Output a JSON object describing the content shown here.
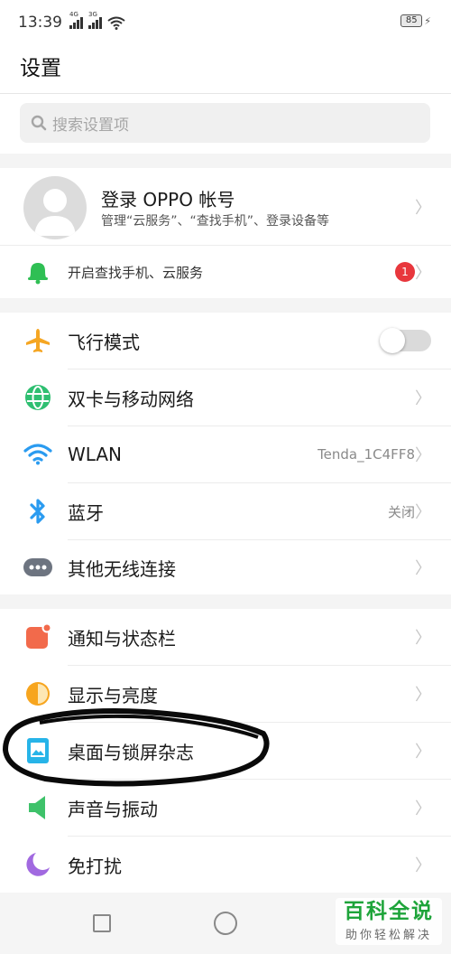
{
  "status_bar": {
    "time": "13:39",
    "net1": "4G",
    "net2": "3G",
    "battery": "85"
  },
  "header": {
    "title": "设置"
  },
  "search": {
    "placeholder": "搜索设置项"
  },
  "account": {
    "title": "登录 OPPO 帐号",
    "subtitle": "管理“云服务”、“查找手机”、登录设备等"
  },
  "find_phone": {
    "label": "开启查找手机、云服务",
    "badge": "1"
  },
  "network": {
    "airplane": {
      "label": "飞行模式",
      "on": false
    },
    "dual_sim": {
      "label": "双卡与移动网络"
    },
    "wlan": {
      "label": "WLAN",
      "value": "Tenda_1C4FF8"
    },
    "bluetooth": {
      "label": "蓝牙",
      "value": "关闭"
    },
    "other_wireless": {
      "label": "其他无线连接"
    }
  },
  "display": {
    "notifications": {
      "label": "通知与状态栏"
    },
    "brightness": {
      "label": "显示与亮度"
    },
    "wallpaper": {
      "label": "桌面与锁屏杂志"
    },
    "sound": {
      "label": "声音与振动"
    },
    "dnd": {
      "label": "免打扰"
    }
  },
  "watermark": {
    "title": "百科全说",
    "subtitle": "助你轻松解决"
  },
  "colors": {
    "toggle_off": "#dadada",
    "badge": "#e8373d",
    "airplane": "#f5a623",
    "network": "#2fbf71",
    "wifi": "#2a9bf0",
    "bluetooth": "#2a9bf0",
    "brand_green": "#1ea43a"
  }
}
